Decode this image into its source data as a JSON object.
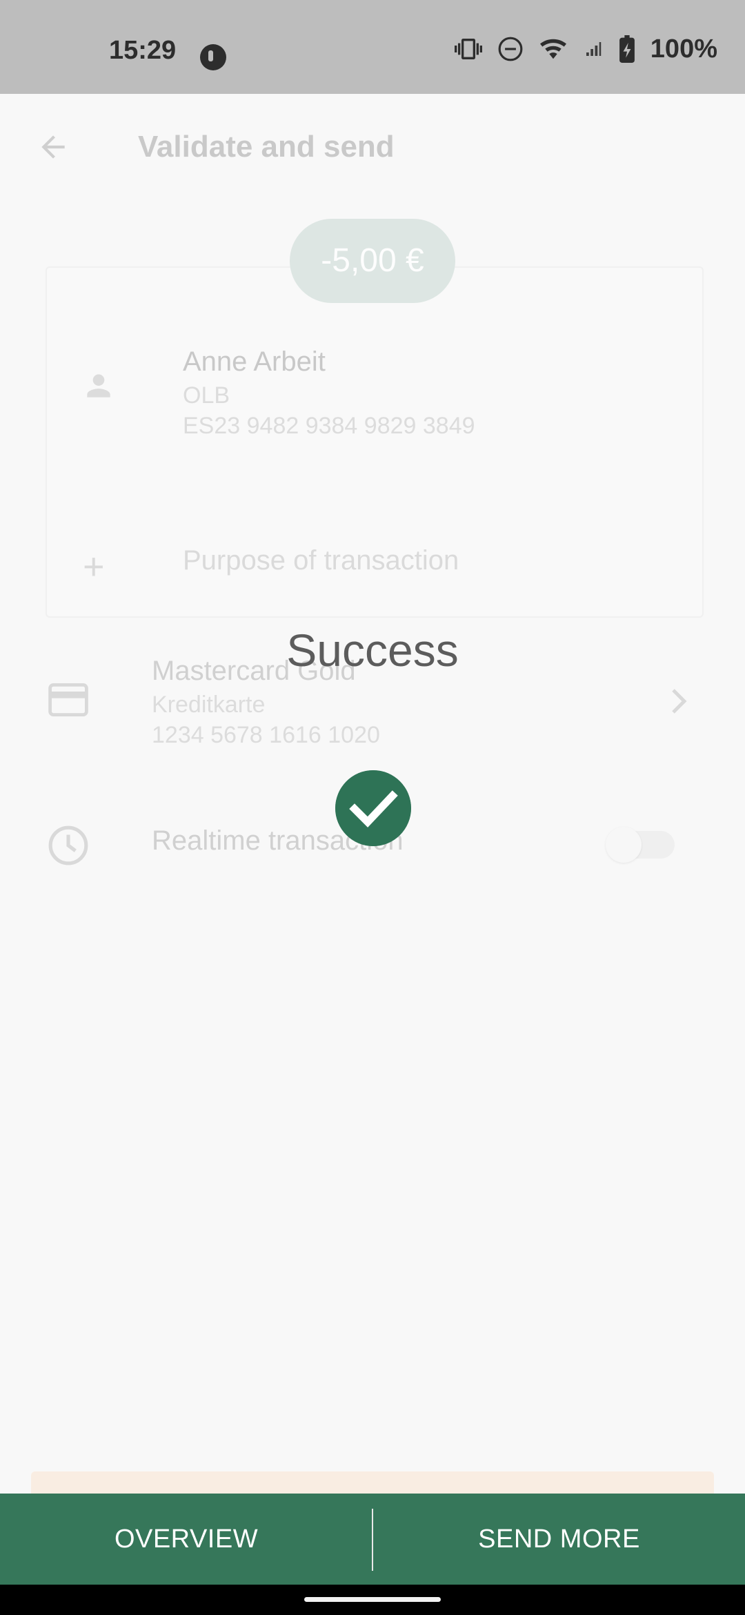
{
  "status_bar": {
    "time": "15:29",
    "battery": "100%",
    "icons": [
      "app-notification-icon",
      "vibrate-icon",
      "do-not-disturb-icon",
      "wifi-icon",
      "signal-icon",
      "battery-charging-icon"
    ]
  },
  "header": {
    "title": "Validate and send",
    "back_icon": "arrow-left-icon"
  },
  "transfer": {
    "amount": "-5,00 €",
    "recipient": {
      "name": "Anne Arbeit",
      "bank": "OLB",
      "iban": "ES23 9482 9384 9829 3849"
    },
    "purpose_placeholder": "Purpose of transaction"
  },
  "account": {
    "name": "Mastercard Gold",
    "type": "Kreditkarte",
    "number": "1234 5678 1616 1020"
  },
  "realtime": {
    "label": "Realtime transaction",
    "enabled": false
  },
  "overlay": {
    "title": "Success",
    "icon": "check-circle-icon"
  },
  "actions": {
    "overview": "OVERVIEW",
    "send_more": "SEND MORE"
  },
  "colors": {
    "accent": "#36775a",
    "check": "#2e7356",
    "amount_pill": "#dde6e3",
    "status_bar": "#bdbdbd"
  }
}
